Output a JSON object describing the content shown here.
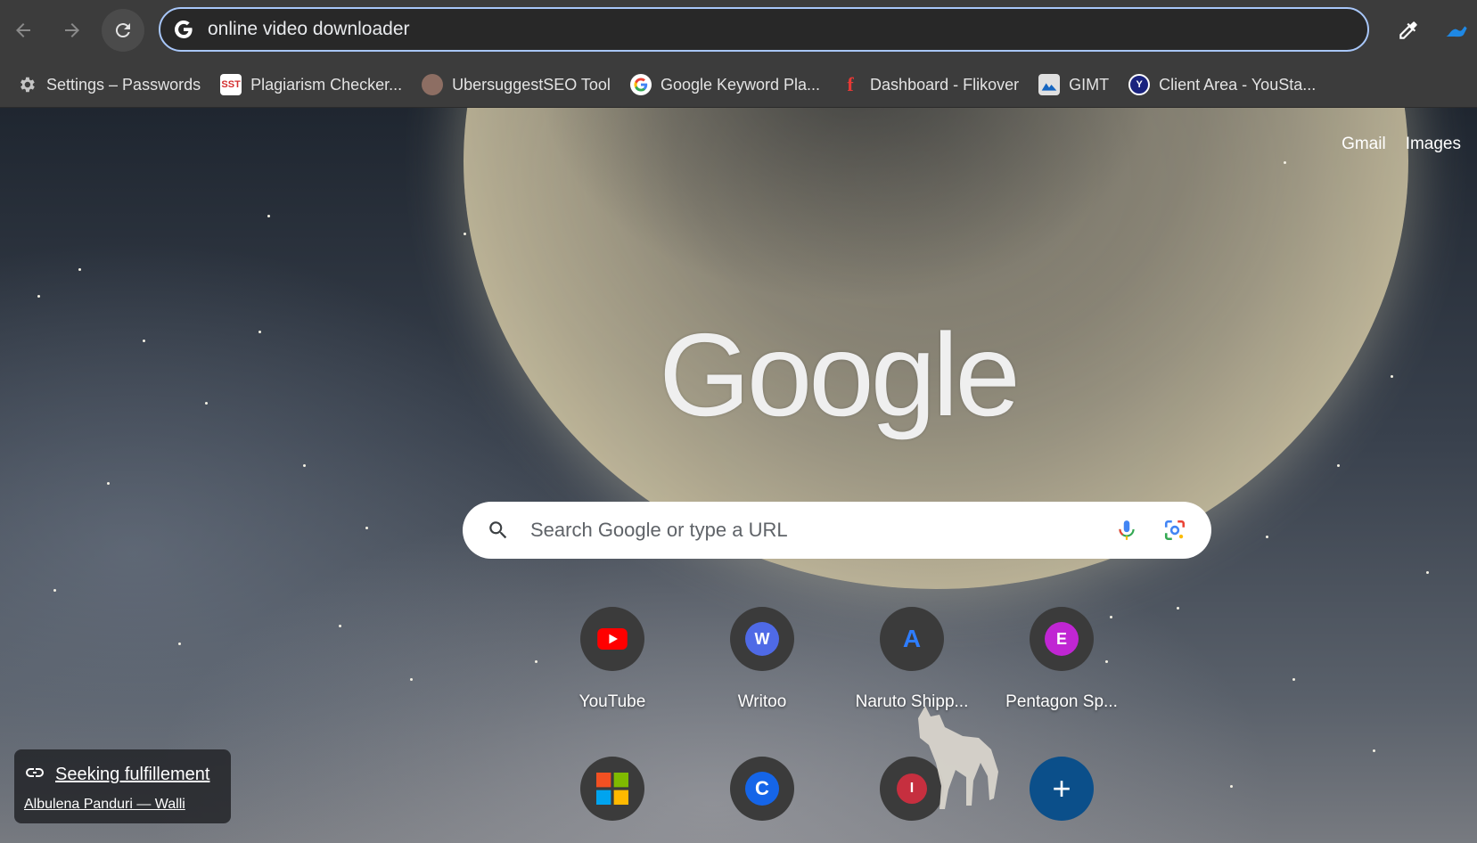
{
  "omnibox": {
    "value": "online video downloader"
  },
  "bookmarks": [
    {
      "label": "Settings – Passwords",
      "icon": "gear-icon"
    },
    {
      "label": "Plagiarism Checker...",
      "icon": "sst-favicon"
    },
    {
      "label": "UbersuggestSEO Tool",
      "icon": "avatar-favicon"
    },
    {
      "label": "Google Keyword Pla...",
      "icon": "google-favicon"
    },
    {
      "label": "Dashboard - Flikover",
      "icon": "flikover-favicon"
    },
    {
      "label": "GIMT",
      "icon": "gimt-favicon"
    },
    {
      "label": "Client Area - YouSta...",
      "icon": "youstable-favicon"
    }
  ],
  "header_links": {
    "gmail": "Gmail",
    "images": "Images"
  },
  "logo": "Google",
  "search": {
    "placeholder": "Search Google or type a URL"
  },
  "shortcuts_row1": [
    {
      "title": "YouTube",
      "icon": "youtube-icon"
    },
    {
      "title": "Writoo",
      "icon": "writoo-icon",
      "letter": "W"
    },
    {
      "title": "Naruto Shipp...",
      "icon": "naruto-icon",
      "letter": "A"
    },
    {
      "title": "Pentagon Sp...",
      "icon": "pentagon-icon",
      "letter": "E"
    }
  ],
  "shortcuts_row2": [
    {
      "icon": "microsoft-icon"
    },
    {
      "icon": "c-logo-icon",
      "letter": "C"
    },
    {
      "icon": "i-logo-icon",
      "letter": "I"
    },
    {
      "icon": "add-shortcut-icon",
      "letter": "+"
    }
  ],
  "attribution": {
    "title": "Seeking fulfillement",
    "author": "Albulena Panduri — Walli"
  },
  "colors": {
    "accent": "#a8c7fa",
    "toolbar": "#3c3c3c",
    "add_button": "#0b4f8a"
  }
}
